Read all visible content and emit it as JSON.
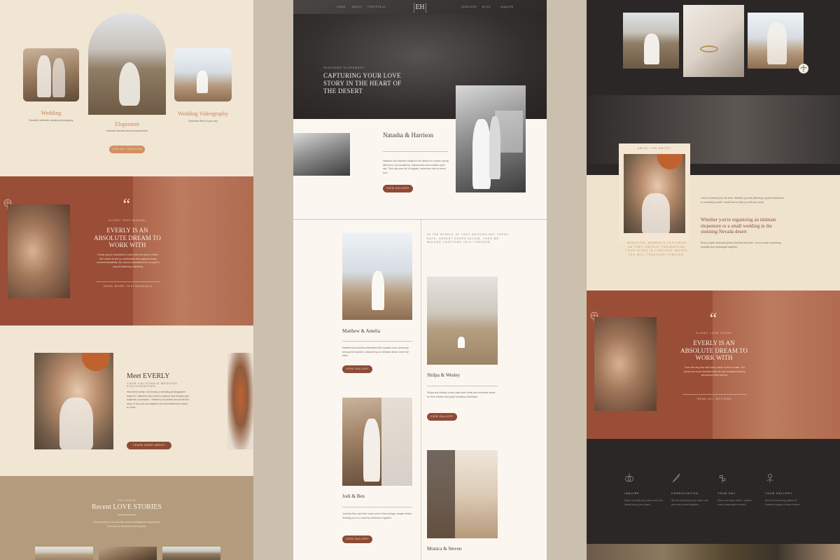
{
  "left": {
    "gallery": {
      "item1_title": "Wedding",
      "item1_text": "Beautiful authentic wedding photography",
      "item2_title": "Elopement",
      "item2_text": "Intimate and adventurous elopements",
      "item3_title": "Wedding Videography",
      "item3_text": "Cinematic films of your day",
      "button": "VIEW ALL SERVICES"
    },
    "testimonial": {
      "quote_mark": "“",
      "eyebrow": "CLIENT TESTIMONIAL",
      "heading": "EVERLY IS AN ABSOLUTE DREAM TO WORK WITH",
      "body": "Everly was so wonderful to work with from start to finish. She made us feel so comfortable and captured every moment beautifully. We cannot recommend her enough to anyone planning a wedding.",
      "link": "READ MORE TESTIMONIALS"
    },
    "meet": {
      "title": "Meet EVERLY",
      "subtitle": "YOUR CALIFORNIA WEDDING PHOTOGRAPHER",
      "body": "Hey there lovely! I am Everly, a wedding photographer based in California who loves to capture real emotion and authentic connection. I believe your photos should tell the story of who you are together and feel timeless for years to come.",
      "button": "LEARN MORE ABOUT EVERLY"
    },
    "stories": {
      "eyebrow": "FEATURED",
      "title": "Recent LOVE STORIES",
      "body": "Explore some of our favorite recent weddings and elopements from across the desert and beyond."
    }
  },
  "middle": {
    "nav": {
      "links_left": [
        "HOME",
        "ABOUT",
        "PORTFOLIO"
      ],
      "logo": "EH",
      "links_right": [
        "SERVICES",
        "BLOG",
        "INQUIRE"
      ]
    },
    "hero": {
      "eyebrow": "FEATURED ELOPEMENT",
      "title": "CAPTURING YOUR LOVE STORY IN THE HEART OF THE DESERT"
    },
    "featured": {
      "names": "Natasha & Harrison",
      "body": "Natasha and Harrison eloped in the desert on a warm spring afternoon, surrounded by Joshua trees and endless open sky. Their day was full of laughter, adventure and so much love.",
      "button": "VIEW GALLERY"
    },
    "intro": "IN THE MIDDLE OF VAST ARIZONA BAY THESE DAYS, DESERT ROSES BLOOM. THEN WE WALKED TOGETHER INTO FOREVER.",
    "stories": [
      {
        "names": "Matthew & Amelia",
        "body": "Matthew and Amelia celebrated with a golden hour ceremony among the boulders, followed by an intimate dinner under the stars.",
        "button": "VIEW GALLERY"
      },
      {
        "names": "Shilpa & Wesley",
        "body": "Shilpa and Wesley chose wide open fields and mountain views for their relaxed and joyful wedding celebration.",
        "button": "VIEW GALLERY"
      },
      {
        "names": "Jodi & Ben",
        "body": "Jodi and Ben said their vows next to their vintage camper before heading out on a road trip adventure together.",
        "button": "VIEW GALLERY"
      },
      {
        "names": "Monica & Steven",
        "body": "",
        "button": ""
      }
    ]
  },
  "right": {
    "about": {
      "eyebrow": "ABOUT THE ARTIST",
      "body_top": "I am so honored you are here. Whether you are planning a grand celebration or something small, I would love to help you tell your story.",
      "heading": "Whether you're organizing an intimate elopement or a small wedding in the stunning Nevada desert",
      "body_bottom": "Every couple deserves photos that feel like them. Let us create something beautiful and meaningful together.",
      "quote": "BEAUTIFUL MOMENTS CAPTURED AS THEY UNFOLD, PRESERVING YOUR STORY IN TIMELESS IMAGES YOU WILL TREASURE FOREVER."
    },
    "testimonial": {
      "quote_mark": "“",
      "eyebrow": "CLIENT LOVE STORY",
      "heading": "EVERLY IS AN ABSOLUTE DREAM TO WORK WITH",
      "body": "From the very first call Everly made us feel at ease. The photos are more beautiful than we ever imagined and we will cherish them forever.",
      "link": "READ ALL REVIEWS"
    },
    "process": [
      {
        "title": "INQUIRE",
        "text": "Reach out with your date and a few details about your plans."
      },
      {
        "title": "CONSULTATION",
        "text": "We will chat about your vision and plan every detail together."
      },
      {
        "title": "YOUR DAY",
        "text": "Relax and enjoy while I capture every meaningful moment."
      },
      {
        "title": "YOUR GALLERY",
        "text": "Receive a stunning gallery of timeless images to keep forever."
      }
    ]
  }
}
